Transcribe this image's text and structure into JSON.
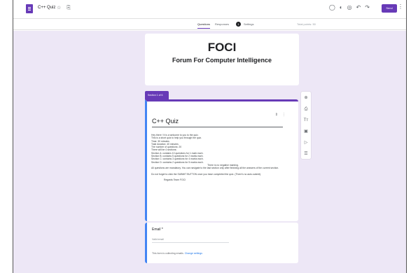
{
  "app": {
    "doc_title": "C++ Quiz",
    "title_icons": "☆ ⎘",
    "right_icons": [
      "◯",
      "◐",
      "◎",
      "↶",
      "↷"
    ],
    "send_label": "Send",
    "more_label": "⋮"
  },
  "tabs": {
    "questions": "Questions",
    "responses": "Responses",
    "responses_count": "1",
    "settings": "Settings",
    "total_points": "Total points: 50"
  },
  "form": {
    "title": "FOCI",
    "subtitle": "Forum For Computer Intelligence"
  },
  "section": {
    "tab_label": "Section 1 of 6",
    "title": "C++ Quiz",
    "description_lines": [
      "Hey there ! It is a welcome to you to the quiz.",
      "This is a short quiz to help you through the quiz.",
      "Time: 30 minutes",
      "Total duration: 40 minutes",
      "The number of questions: 20",
      "There will be 4 sections:",
      "Section A: contains 10 questions for 1 mark each.",
      "Section B: contains 5 questions for 2 marks each.",
      "Section C: contains 3 questions for 4 marks each.",
      "Section D: contains 2 questions for 5 marks each."
    ],
    "negative_marking": "There is no negative marking.",
    "description_lines_2": [
      "All questions are mandatory. You can navigate to the last section only after finishing all the answers of the current section.",
      "",
      "Do not forget to click the SUBMIT BUTTON once you have completed the quiz. (There's no auto-submit)."
    ],
    "sign_off": "Regards Team FOCI"
  },
  "side_toolbar": [
    "⊕",
    "⎙",
    "Tт",
    "▣",
    "▷",
    "☰"
  ],
  "email_question": {
    "label": "Email *",
    "placeholder": "Valid email",
    "note_prefix": "This form is collecting emails.",
    "note_link": "Change settings"
  }
}
